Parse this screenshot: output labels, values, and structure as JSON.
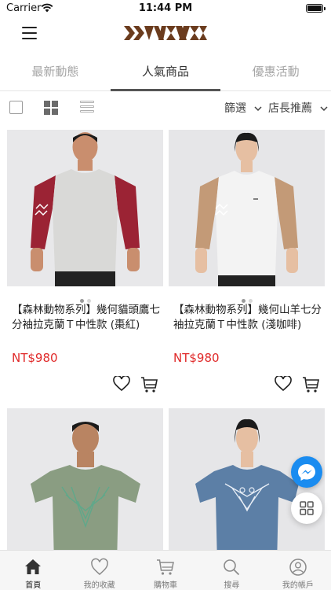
{
  "status": {
    "carrier": "Carrier",
    "time": "11:44 PM"
  },
  "tabs": [
    {
      "label": "最新動態"
    },
    {
      "label": "人氣商品"
    },
    {
      "label": "優惠活動"
    }
  ],
  "toolbar": {
    "filter_label": "篩選",
    "sort_label": "店長推薦"
  },
  "products": [
    {
      "title": "【森林動物系列】幾何貓頭鷹七分袖拉克蘭Ｔ中性款 (棗紅)",
      "price": "NT$980",
      "sleeve_color": "#9b2334",
      "shirt_color": "#d9d9d7"
    },
    {
      "title": "【森林動物系列】幾何山羊七分袖拉克蘭Ｔ中性款 (淺咖啡)",
      "price": "NT$980",
      "sleeve_color": "#c39a77",
      "shirt_color": "#f3f3f3"
    },
    {
      "shirt_color": "#8a9d82"
    },
    {
      "shirt_color": "#5c7fa6"
    }
  ],
  "bottom_nav": [
    {
      "label": "首頁"
    },
    {
      "label": "我的收藏"
    },
    {
      "label": "購物車"
    },
    {
      "label": "搜尋"
    },
    {
      "label": "我的帳戶"
    }
  ],
  "colors": {
    "price": "#e02a2a",
    "messenger": "#1a8cf0",
    "logo": "#6b3c1e"
  }
}
